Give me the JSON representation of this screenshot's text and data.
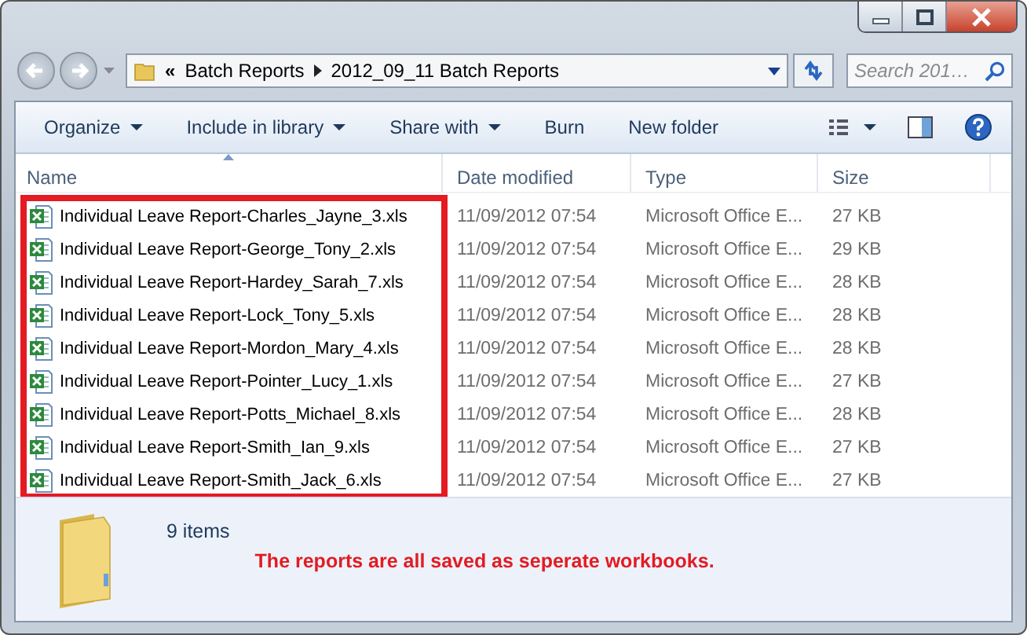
{
  "address": {
    "overflow": "«",
    "path": [
      "Batch Reports",
      "2012_09_11 Batch Reports"
    ]
  },
  "search": {
    "placeholder": "Search 201…"
  },
  "toolbar": [
    {
      "label": "Organize",
      "dropdown": true
    },
    {
      "label": "Include in library",
      "dropdown": true
    },
    {
      "label": "Share with",
      "dropdown": true
    },
    {
      "label": "Burn",
      "dropdown": false
    },
    {
      "label": "New folder",
      "dropdown": false
    }
  ],
  "columns": [
    {
      "label": "Name",
      "sorted": true
    },
    {
      "label": "Date modified",
      "sorted": false
    },
    {
      "label": "Type",
      "sorted": false
    },
    {
      "label": "Size",
      "sorted": false
    }
  ],
  "rows": [
    {
      "name": "Individual Leave Report-Charles_Jayne_3.xls",
      "date": "11/09/2012 07:54",
      "type": "Microsoft Office E...",
      "size": "27 KB"
    },
    {
      "name": "Individual Leave Report-George_Tony_2.xls",
      "date": "11/09/2012 07:54",
      "type": "Microsoft Office E...",
      "size": "29 KB"
    },
    {
      "name": "Individual Leave Report-Hardey_Sarah_7.xls",
      "date": "11/09/2012 07:54",
      "type": "Microsoft Office E...",
      "size": "28 KB"
    },
    {
      "name": "Individual Leave Report-Lock_Tony_5.xls",
      "date": "11/09/2012 07:54",
      "type": "Microsoft Office E...",
      "size": "28 KB"
    },
    {
      "name": "Individual Leave Report-Mordon_Mary_4.xls",
      "date": "11/09/2012 07:54",
      "type": "Microsoft Office E...",
      "size": "28 KB"
    },
    {
      "name": "Individual Leave Report-Pointer_Lucy_1.xls",
      "date": "11/09/2012 07:54",
      "type": "Microsoft Office E...",
      "size": "27 KB"
    },
    {
      "name": "Individual Leave Report-Potts_Michael_8.xls",
      "date": "11/09/2012 07:54",
      "type": "Microsoft Office E...",
      "size": "28 KB"
    },
    {
      "name": "Individual Leave Report-Smith_Ian_9.xls",
      "date": "11/09/2012 07:54",
      "type": "Microsoft Office E...",
      "size": "27 KB"
    },
    {
      "name": "Individual Leave Report-Smith_Jack_6.xls",
      "date": "11/09/2012 07:54",
      "type": "Microsoft Office E...",
      "size": "27 KB"
    }
  ],
  "status": {
    "count": "9 items"
  },
  "annotation": {
    "text": "The reports are all saved as seperate workbooks."
  }
}
